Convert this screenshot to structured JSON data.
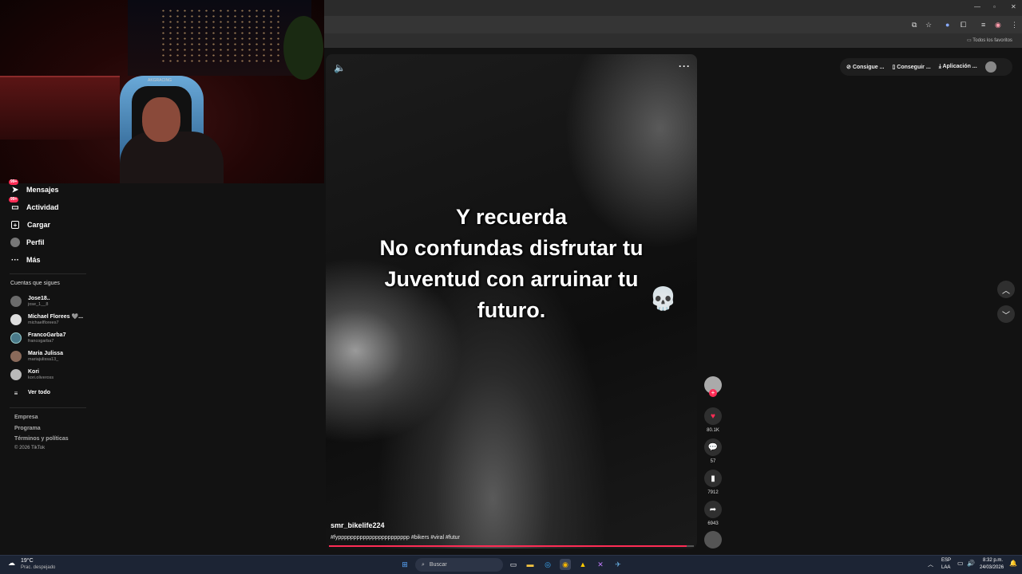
{
  "webcam": {
    "chair_logo": "AKGRACING"
  },
  "sidebar": {
    "nav": [
      {
        "label": "Mensajes",
        "badge": "99+",
        "icon": "send-icon"
      },
      {
        "label": "Actividad",
        "badge": "99+",
        "icon": "message-icon"
      },
      {
        "label": "Cargar",
        "icon": "plus-square-icon"
      },
      {
        "label": "Perfil",
        "icon": "avatar-icon"
      },
      {
        "label": "Más",
        "icon": "more-icon"
      }
    ],
    "following_title": "Cuentas que sigues",
    "accounts": [
      {
        "name": "Jose18..",
        "handle": "jose_1__8"
      },
      {
        "name": "Michael Florees 🩶...",
        "handle": "michaelflorees7"
      },
      {
        "name": "FrancoGarba7",
        "handle": "francogarba7"
      },
      {
        "name": "Maria Julissa",
        "handle": "mariajulissa13_"
      },
      {
        "name": "Kori",
        "handle": "kori.oliveross"
      }
    ],
    "see_all": "Ver todo",
    "footer": [
      "Empresa",
      "Programa",
      "Términos y políticas",
      "© 2026 TikTok"
    ]
  },
  "browser": {
    "bookmarks_label": "Todos los favoritos",
    "top_pills": [
      "Consigue ...",
      "Conseguir ...",
      "Aplicación ..."
    ]
  },
  "video": {
    "overlay_lines": [
      "Y recuerda",
      "No confundas disfrutar tu",
      "Juventud con arruinar tu",
      "futuro."
    ],
    "skull": "💀",
    "author": "smr_bikelife224",
    "hashtags": "#fyppppppppppppppppppppppp #bikers #viral #futur",
    "progress": 0.98
  },
  "actions": {
    "likes": "80.1K",
    "comments": "57",
    "saves": "7912",
    "shares": "6943"
  },
  "taskbar": {
    "temp": "19°C",
    "weather": "Prac. despejado",
    "search": "Buscar",
    "lang1": "ESP",
    "lang2": "LAA",
    "time": "8:32 p.m.",
    "date": "24/03/2026"
  },
  "colors": {
    "accent": "#fe2c55",
    "background": "#121212"
  }
}
